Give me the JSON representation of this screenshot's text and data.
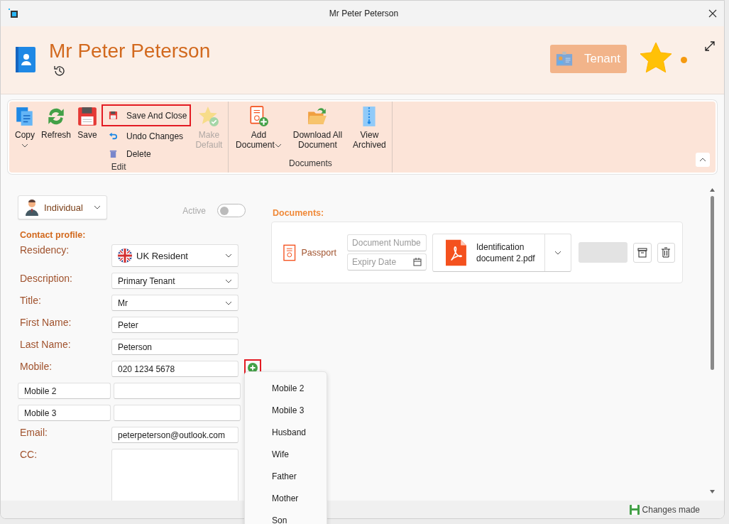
{
  "window": {
    "title": "Mr Peter Peterson"
  },
  "header": {
    "name": "Mr Peter Peterson",
    "badge": "Tenant",
    "favorite": true
  },
  "ribbon": {
    "groups": [
      {
        "label": "Edit",
        "items": [
          {
            "kind": "large",
            "label": "Copy",
            "dropdown": true,
            "disabled": false,
            "highlighted": false
          },
          {
            "kind": "large",
            "label": "Refresh",
            "dropdown": false,
            "disabled": false,
            "highlighted": false
          },
          {
            "kind": "large",
            "label": "Save",
            "dropdown": false,
            "disabled": false,
            "highlighted": false
          },
          {
            "kind": "small",
            "label": "Save And Close",
            "dropdown": false,
            "disabled": false,
            "highlighted": true
          },
          {
            "kind": "small",
            "label": "Undo Changes",
            "dropdown": false,
            "disabled": false,
            "highlighted": false
          },
          {
            "kind": "small",
            "label": "Delete",
            "dropdown": false,
            "disabled": false,
            "highlighted": false
          },
          {
            "kind": "large",
            "label": "Make Default",
            "dropdown": false,
            "disabled": true,
            "highlighted": false
          }
        ]
      },
      {
        "label": "Documents",
        "items": [
          {
            "kind": "large",
            "label": "Add Document",
            "dropdown": true,
            "disabled": false,
            "highlighted": false
          },
          {
            "kind": "large",
            "label": "Download All Document",
            "dropdown": false,
            "disabled": false,
            "highlighted": false
          },
          {
            "kind": "large",
            "label": "View Archived",
            "dropdown": false,
            "disabled": false,
            "highlighted": false
          }
        ]
      }
    ]
  },
  "contact_type": {
    "value": "Individual"
  },
  "active": {
    "label": "Active",
    "on": false
  },
  "section_title": "Contact profile:",
  "fields": [
    {
      "kind": "select",
      "label": "Residency:",
      "value": "UK Resident",
      "flag": true
    },
    {
      "kind": "select",
      "label": "Description:",
      "value": "Primary Tenant",
      "flag": false
    },
    {
      "kind": "select",
      "label": "Title:",
      "value": "Mr",
      "flag": false
    },
    {
      "kind": "text",
      "label": "First Name:",
      "value": "Peter"
    },
    {
      "kind": "text",
      "label": "Last Name:",
      "value": "Peterson"
    },
    {
      "kind": "text",
      "label": "Mobile:",
      "value": "020 1234 5678",
      "add_highlighted": true
    },
    {
      "kind": "custom",
      "label": "Mobile 2"
    },
    {
      "kind": "custom",
      "label": "Mobile 3"
    },
    {
      "kind": "text",
      "label": "Email:",
      "value": "peterpeterson@outlook.com"
    },
    {
      "kind": "textarea",
      "label": "CC:"
    }
  ],
  "menu": {
    "items": [
      "Mobile 2",
      "Mobile 3",
      "Husband",
      "Wife",
      "Father",
      "Mother",
      "Son"
    ]
  },
  "documents": {
    "title": "Documents:",
    "rows": [
      {
        "type": "Passport",
        "number_placeholder": "Document Numbe",
        "expiry_placeholder": "Expiry Date",
        "file": "Identification document 2.pdf"
      }
    ]
  },
  "status_bar": {
    "text": "Changes made"
  }
}
